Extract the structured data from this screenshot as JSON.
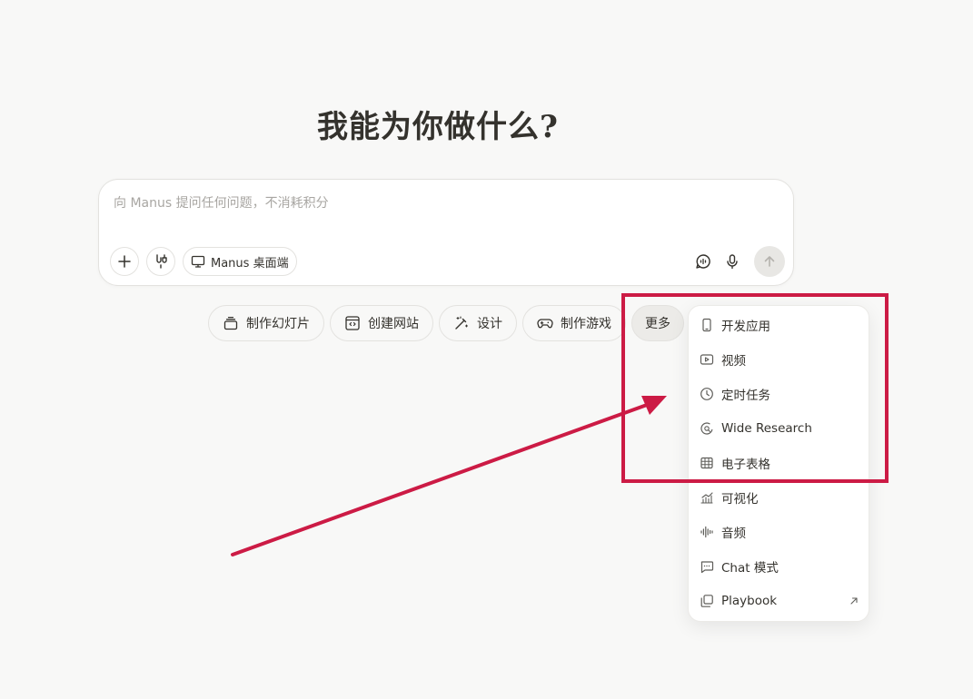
{
  "heading": "我能为你做什么?",
  "composer": {
    "placeholder": "向 Manus 提问任何问题，不消耗积分",
    "desktop_label": "Manus 桌面端"
  },
  "chips": [
    {
      "label": "制作幻灯片",
      "icon": "slides-icon"
    },
    {
      "label": "创建网站",
      "icon": "website-icon"
    },
    {
      "label": "设计",
      "icon": "design-wand-icon"
    },
    {
      "label": "制作游戏",
      "icon": "gamepad-icon"
    },
    {
      "label": "更多",
      "icon": ""
    }
  ],
  "menu": {
    "items": [
      {
        "label": "开发应用",
        "icon": "phone-icon"
      },
      {
        "label": "视频",
        "icon": "video-icon"
      },
      {
        "label": "定时任务",
        "icon": "clock-icon"
      },
      {
        "label": "Wide Research",
        "icon": "research-globe-icon"
      },
      {
        "label": "电子表格",
        "icon": "table-icon"
      },
      {
        "label": "可视化",
        "icon": "chart-icon"
      },
      {
        "label": "音频",
        "icon": "audio-wave-icon"
      },
      {
        "label": "Chat 模式",
        "icon": "chat-icon"
      },
      {
        "label": "Playbook",
        "icon": "playbook-icon"
      }
    ]
  },
  "annotation": {
    "color": "#cc1b45"
  }
}
